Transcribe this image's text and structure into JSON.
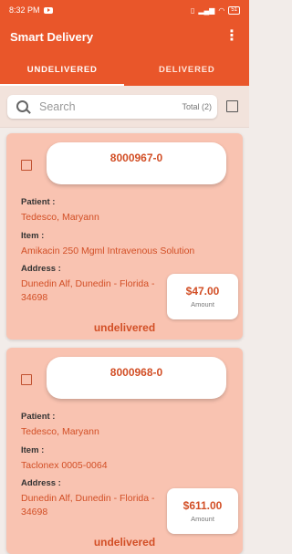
{
  "status_bar": {
    "time": "8:32 PM",
    "battery": "51"
  },
  "app": {
    "title": "Smart Delivery"
  },
  "tabs": [
    {
      "label": "UNDELIVERED"
    },
    {
      "label": "DELIVERED"
    }
  ],
  "search": {
    "placeholder": "Search",
    "total": "Total (2)"
  },
  "labels": {
    "patient": "Patient :",
    "item": "Item :",
    "address": "Address :",
    "amount": "Amount"
  },
  "orders": [
    {
      "id": "8000967-0",
      "patient": "Tedesco, Maryann",
      "item": "Amikacin 250 Mgml Intravenous Solution",
      "address": "Dunedin Alf, Dunedin - Florida - 34698",
      "price": "$47.00",
      "status": "undelivered"
    },
    {
      "id": "8000968-0",
      "patient": "Tedesco, Maryann",
      "item": "Taclonex 0005-0064",
      "address": "Dunedin Alf, Dunedin - Florida - 34698",
      "price": "$611.00",
      "status": "undelivered"
    }
  ],
  "colors": {
    "primary": "#e9562a",
    "card_bg": "#f9c3b1",
    "accent_text": "#d24f26"
  },
  "icons": {
    "search": "search-icon",
    "menu": "more-vert-icon",
    "checkbox": "checkbox-icon"
  }
}
